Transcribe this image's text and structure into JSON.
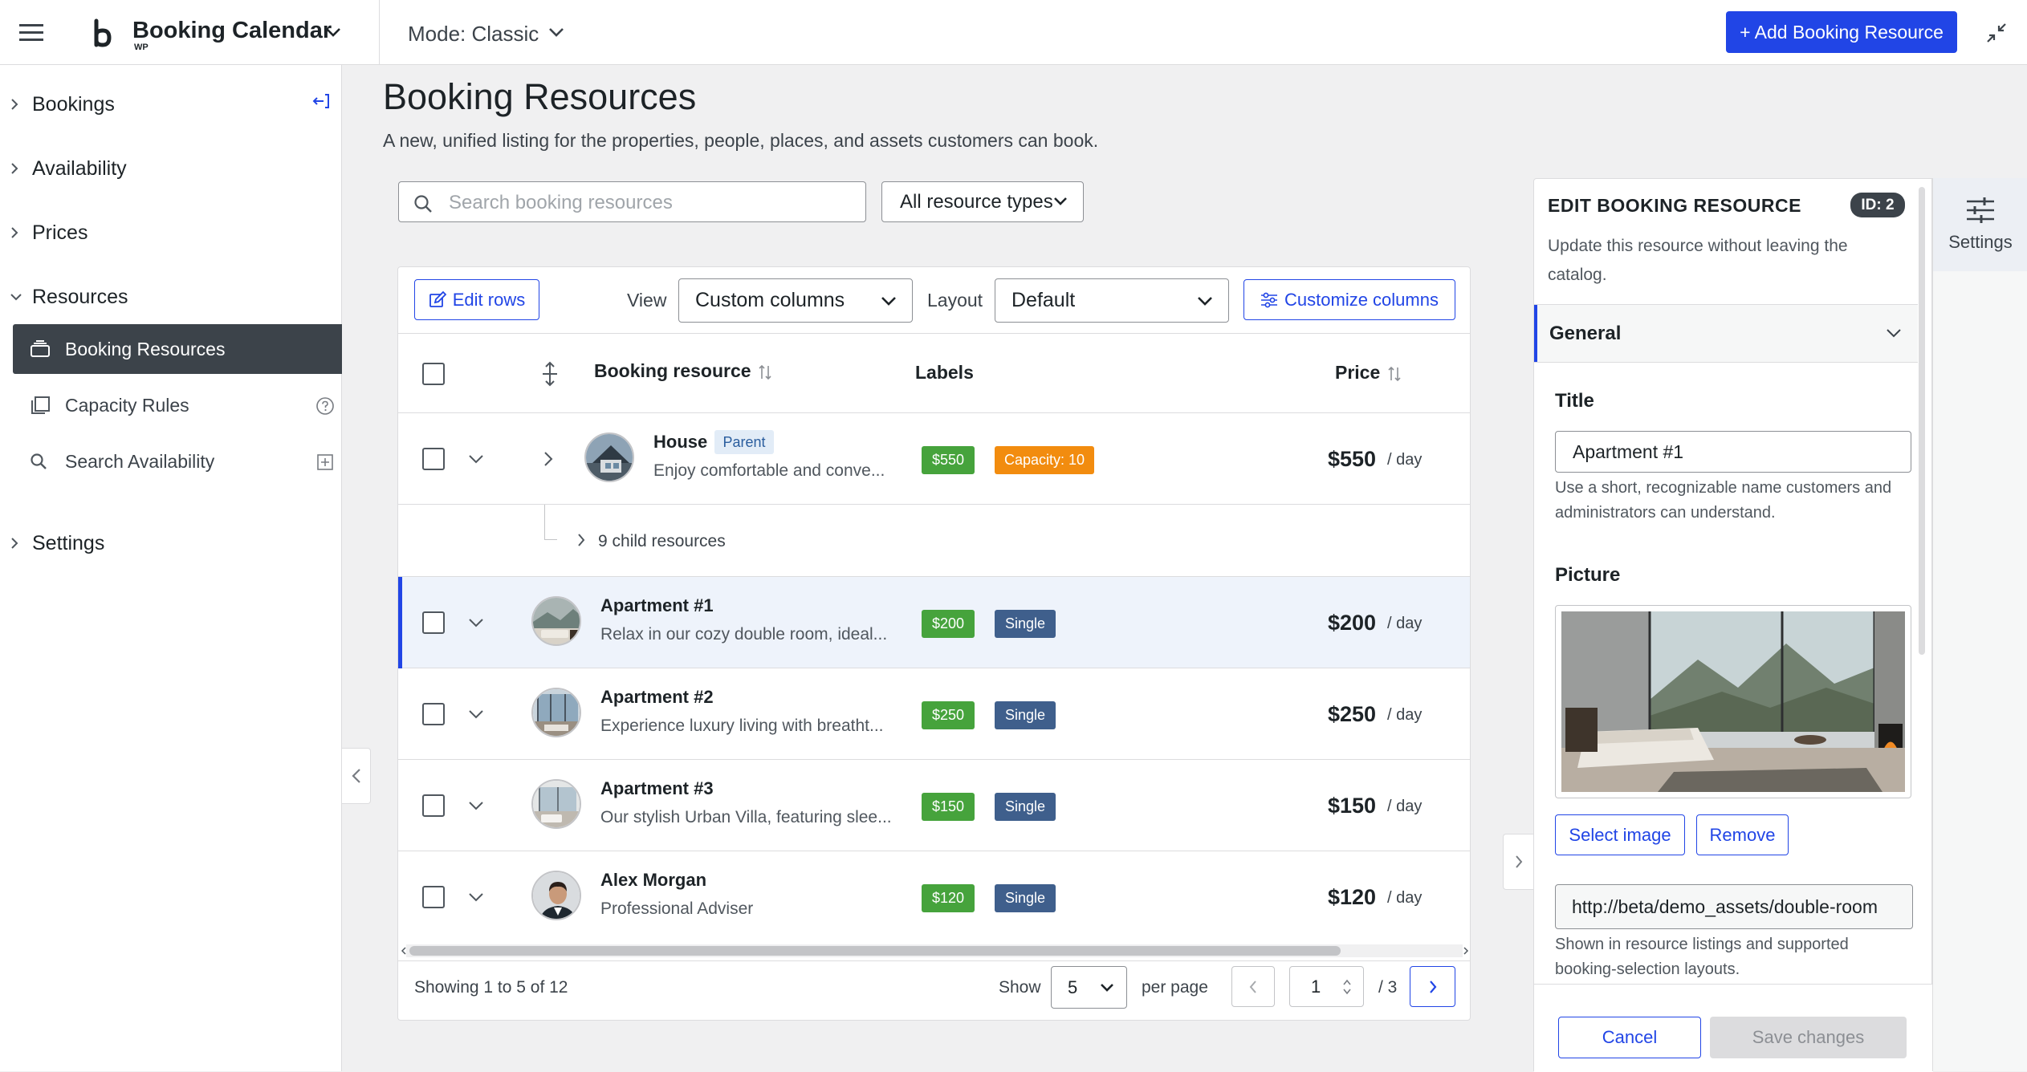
{
  "topbar": {
    "app_title": "Booking Calendar",
    "app_sub": "WP",
    "mode_label": "Mode: Classic",
    "add_button": "+ Add Booking Resource"
  },
  "sidebar": {
    "groups": [
      {
        "label": "Bookings"
      },
      {
        "label": "Availability"
      },
      {
        "label": "Prices"
      },
      {
        "label": "Resources"
      },
      {
        "label": "Settings"
      }
    ],
    "resources_items": [
      {
        "label": "Booking Resources",
        "icon": "stack-icon"
      },
      {
        "label": "Capacity Rules",
        "icon": "copy-icon"
      },
      {
        "label": "Search Availability",
        "icon": "search-icon"
      }
    ]
  },
  "main": {
    "title": "Booking Resources",
    "description": "A new, unified listing for the properties, people, places, and assets customers can book.",
    "search_placeholder": "Search booking resources",
    "type_filter": "All resource types"
  },
  "toolbar": {
    "edit_rows": "Edit rows",
    "view_label": "View",
    "view_value": "Custom columns",
    "layout_label": "Layout",
    "layout_value": "Default",
    "customize": "Customize columns"
  },
  "table": {
    "columns": [
      "Booking resource",
      "Labels",
      "Price"
    ],
    "parent": {
      "name": "House",
      "badge": "Parent",
      "desc": "Enjoy comfortable and conve...",
      "price_label": "$550",
      "capacity_label": "Capacity: 10",
      "price": "$550",
      "per": "/ day",
      "children": "9 child resources"
    },
    "rows": [
      {
        "name": "Apartment #1",
        "desc": "Relax in our cozy double room, ideal...",
        "price_label": "$200",
        "type": "Single",
        "price": "$200",
        "per": "/ day",
        "selected": true
      },
      {
        "name": "Apartment #2",
        "desc": "Experience luxury living with breatht...",
        "price_label": "$250",
        "type": "Single",
        "price": "$250",
        "per": "/ day"
      },
      {
        "name": "Apartment #3",
        "desc": "Our stylish Urban Villa, featuring slee...",
        "price_label": "$150",
        "type": "Single",
        "price": "$150",
        "per": "/ day"
      },
      {
        "name": "Alex Morgan",
        "desc": "Professional Adviser",
        "price_label": "$120",
        "type": "Single",
        "price": "$120",
        "per": "/ day"
      }
    ]
  },
  "footer": {
    "showing": "Showing 1 to 5 of 12",
    "show_label": "Show",
    "per_page_value": "5",
    "per_page_label": "per page",
    "page_value": "1",
    "page_total": "/ 3"
  },
  "edit_panel": {
    "title": "EDIT BOOKING RESOURCE",
    "id_badge": "ID: 2",
    "description": "Update this resource without leaving the catalog.",
    "section": "General",
    "title_label": "Title",
    "title_value": "Apartment #1",
    "title_help": "Use a short, recognizable name customers and administrators can understand.",
    "picture_label": "Picture",
    "select_image": "Select image",
    "remove": "Remove",
    "picture_url": "http://beta/demo_assets/double-room",
    "picture_help": "Shown in resource listings and supported booking-selection layouts.",
    "cancel": "Cancel",
    "save": "Save changes"
  },
  "rail": {
    "settings_label": "Settings"
  },
  "colors": {
    "accent": "#2145e6",
    "sidebar_active": "#3c434a",
    "price_badge": "#46a33c",
    "single_badge": "#3f5f8c",
    "capacity_badge": "#f28c0f"
  }
}
